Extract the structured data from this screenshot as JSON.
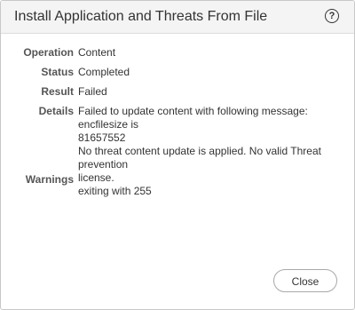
{
  "dialog": {
    "title": "Install Application and Threats From File",
    "help_label": "?"
  },
  "fields": {
    "operation": {
      "label": "Operation",
      "value": "Content"
    },
    "status": {
      "label": "Status",
      "value": "Completed"
    },
    "result": {
      "label": "Result",
      "value": "Failed"
    },
    "details": {
      "label": "Details",
      "lines": [
        "Failed to update content with following message: encfilesize is",
        "81657552",
        "No threat content update is applied. No valid Threat prevention",
        "license.",
        "exiting with 255"
      ]
    },
    "warnings": {
      "label": "Warnings",
      "value": ""
    }
  },
  "footer": {
    "close_label": "Close"
  }
}
